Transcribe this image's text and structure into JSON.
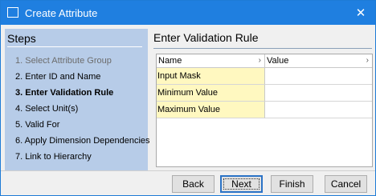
{
  "window": {
    "title": "Create Attribute",
    "icon": "window-icon",
    "close_icon": "close-icon"
  },
  "steps": {
    "title": "Steps",
    "items": [
      {
        "label": "1. Select Attribute Group",
        "state": "disabled"
      },
      {
        "label": "2. Enter ID and Name",
        "state": "normal"
      },
      {
        "label": "3. Enter Validation Rule",
        "state": "current"
      },
      {
        "label": "4. Select Unit(s)",
        "state": "normal"
      },
      {
        "label": "5. Valid For",
        "state": "normal"
      },
      {
        "label": "6. Apply Dimension Dependencies",
        "state": "normal"
      },
      {
        "label": "7. Link to Hierarchy",
        "state": "normal"
      }
    ]
  },
  "main": {
    "heading": "Enter Validation Rule",
    "grid": {
      "columns": [
        "Name",
        "Value"
      ],
      "rows": [
        {
          "name": "Input Mask",
          "value": ""
        },
        {
          "name": "Minimum Value",
          "value": ""
        },
        {
          "name": "Maximum Value",
          "value": ""
        }
      ]
    }
  },
  "buttons": {
    "back": "Back",
    "next": "Next",
    "finish": "Finish",
    "cancel": "Cancel"
  },
  "colors": {
    "titlebar": "#1f7fe0",
    "steps_panel": "#b7cce8",
    "name_cell": "#fff8c0"
  }
}
